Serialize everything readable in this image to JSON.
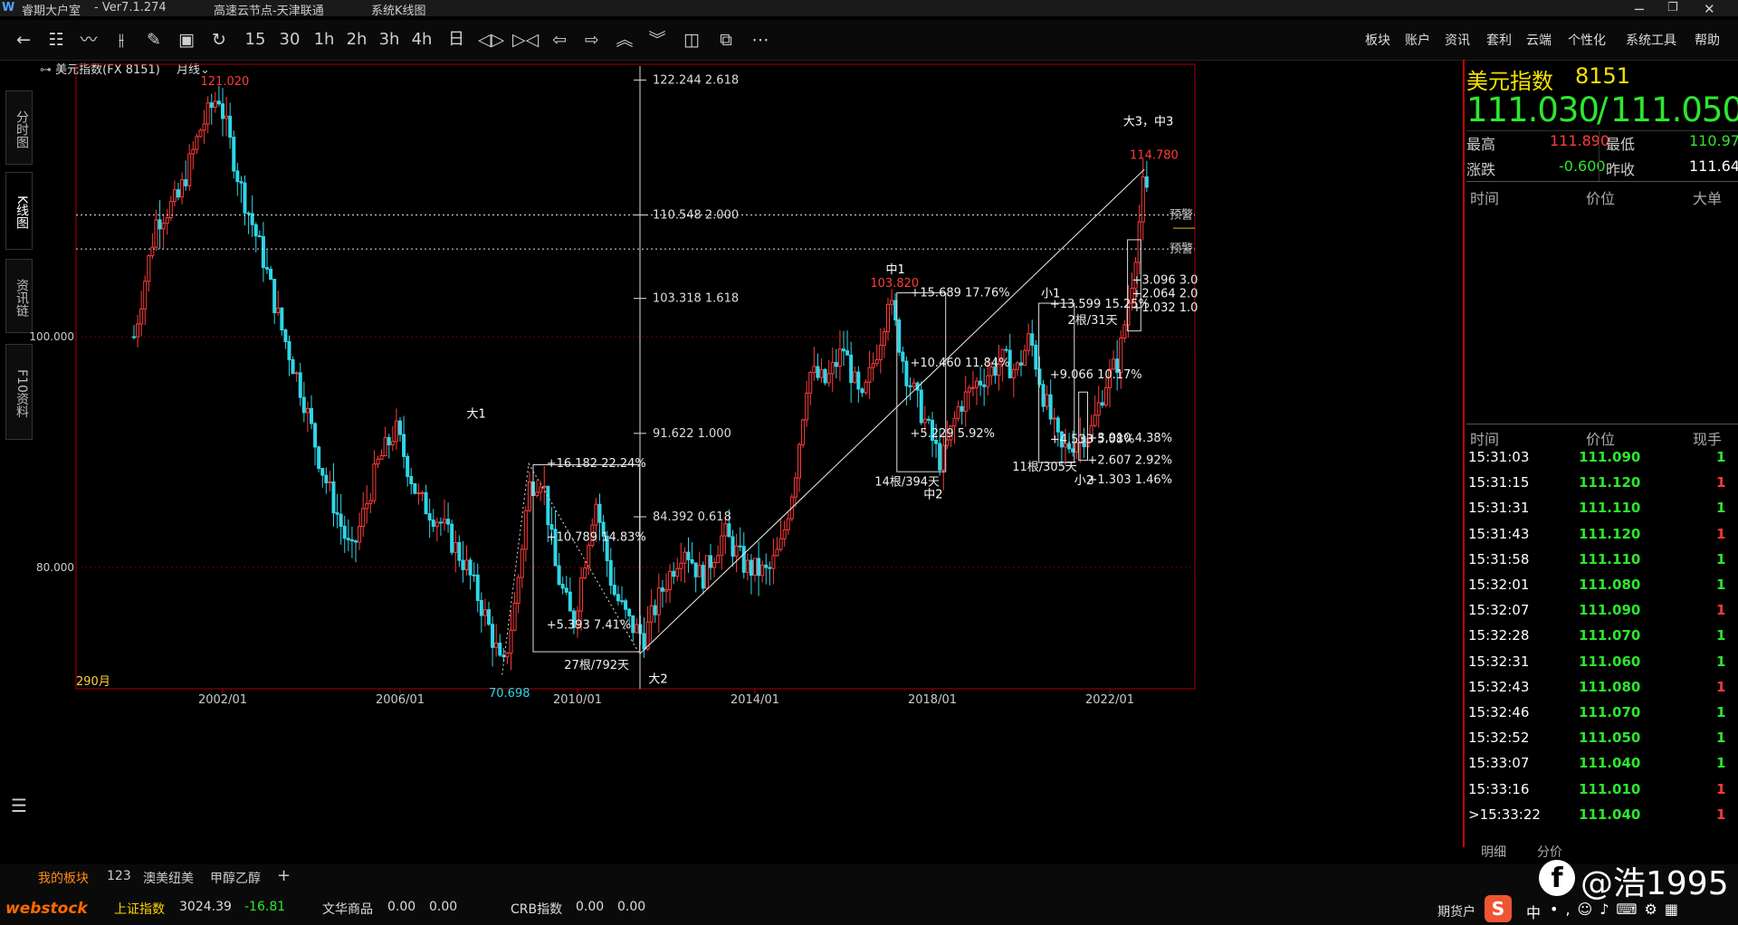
{
  "titlebar": {
    "app_name": "睿期大户室",
    "version": "- Ver7.1.274",
    "server": "高速云节点-天津联通",
    "window_name": "系统K线图"
  },
  "toolbar": {
    "period_buttons": [
      "15",
      "30",
      "1h",
      "2h",
      "3h",
      "4h",
      "日"
    ],
    "menu": [
      "板块",
      "账户",
      "资讯",
      "套利",
      "云端",
      "个性化",
      "系统工具",
      "帮助"
    ]
  },
  "left_tabs": [
    "分时图",
    "K线图",
    "资讯链",
    "F10资料"
  ],
  "chart_header": {
    "symbol": "美元指数(FX 8151)",
    "period": "月线"
  },
  "chart_data": {
    "type": "candlestick",
    "title": "美元指数(FX 8151) 月线",
    "bar_count_label": "290月",
    "x_ticks": [
      "2002/01",
      "2006/01",
      "2010/01",
      "2014/01",
      "2018/01",
      "2022/01"
    ],
    "y_ticks": [
      "100.000",
      "80.000"
    ],
    "high_label": "121.020",
    "low_label": "70.698",
    "peak_mid": "103.820",
    "last_high": "114.780",
    "fib_levels": [
      {
        "price": "122.244",
        "ratio": "2.618"
      },
      {
        "price": "110.548",
        "ratio": "2.000"
      },
      {
        "price": "103.318",
        "ratio": "1.618"
      },
      {
        "price": "91.622",
        "ratio": "1.000"
      },
      {
        "price": "84.392",
        "ratio": "0.618"
      }
    ],
    "wave_labels": [
      "大1",
      "大2",
      "中1",
      "中2",
      "小1",
      "小2",
      "大3，中3"
    ],
    "measure_labels": [
      "+16.182  22.24%",
      "+10.789  14.83%",
      "+5.393  7.41%",
      "27根/792天",
      "+15.689  17.76%",
      "+10.460  11.84%",
      "+5.229  5.92%",
      "14根/394天",
      "+13.599  15.25%",
      "+9.066  10.17%",
      "+4.533  5.08%",
      "11根/305天",
      "+3.910  4.38%",
      "+2.607  2.92%",
      "+1.303  1.46%",
      "2根/31天",
      "+3.096  3.0",
      "+2.064  2.0",
      "+1.032  1.0"
    ],
    "alert_labels": [
      "预警",
      "预警"
    ],
    "alert_prices": [
      110.548,
      107.6
    ]
  },
  "quote": {
    "name": "美元指数",
    "code": "8151",
    "bid": "111.030",
    "ask": "111.050",
    "high_label": "最高",
    "high": "111.890",
    "low_label": "最低",
    "low": "110.970",
    "change_label": "涨跌",
    "change": "-0.600",
    "prev_close_label": "昨收",
    "prev_close": "111.640"
  },
  "big_orders": {
    "headers": [
      "时间",
      "价位",
      "大单"
    ]
  },
  "ticks": {
    "headers": [
      "时间",
      "价位",
      "现手"
    ],
    "rows": [
      {
        "time": "15:31:03",
        "price": "111.090",
        "vol": "1",
        "vcolor": "#2ee62e"
      },
      {
        "time": "15:31:15",
        "price": "111.120",
        "vol": "1",
        "vcolor": "#ff3b3b"
      },
      {
        "time": "15:31:31",
        "price": "111.110",
        "vol": "1",
        "vcolor": "#2ee62e"
      },
      {
        "time": "15:31:43",
        "price": "111.120",
        "vol": "1",
        "vcolor": "#ff3b3b"
      },
      {
        "time": "15:31:58",
        "price": "111.110",
        "vol": "1",
        "vcolor": "#2ee62e"
      },
      {
        "time": "15:32:01",
        "price": "111.080",
        "vol": "1",
        "vcolor": "#2ee62e"
      },
      {
        "time": "15:32:07",
        "price": "111.090",
        "vol": "1",
        "vcolor": "#ff3b3b"
      },
      {
        "time": "15:32:28",
        "price": "111.070",
        "vol": "1",
        "vcolor": "#2ee62e"
      },
      {
        "time": "15:32:31",
        "price": "111.060",
        "vol": "1",
        "vcolor": "#2ee62e"
      },
      {
        "time": "15:32:43",
        "price": "111.080",
        "vol": "1",
        "vcolor": "#ff3b3b"
      },
      {
        "time": "15:32:46",
        "price": "111.070",
        "vol": "1",
        "vcolor": "#2ee62e"
      },
      {
        "time": "15:32:52",
        "price": "111.050",
        "vol": "1",
        "vcolor": "#2ee62e"
      },
      {
        "time": "15:33:07",
        "price": "111.040",
        "vol": "1",
        "vcolor": "#2ee62e"
      },
      {
        "time": "15:33:16",
        "price": "111.010",
        "vol": "1",
        "vcolor": "#ff3b3b"
      },
      {
        "time": "15:33:22",
        "price": "111.040",
        "vol": "1",
        "vcolor": "#ff3b3b"
      }
    ]
  },
  "panel_tabs": [
    "明细",
    "分价"
  ],
  "bottom": {
    "tabs": [
      "我的板块",
      "123",
      "澳美纽美",
      "甲醇乙醇"
    ],
    "add": "+",
    "brand": "webstock",
    "tickers": [
      {
        "name": "上证指数",
        "value": "3024.39",
        "change": "-16.81"
      },
      {
        "name": "文华商品",
        "value": "0.00",
        "change": "0.00"
      },
      {
        "name": "CRB指数",
        "value": "0.00",
        "change": "0.00"
      }
    ],
    "account_type": "期货户",
    "ime": "中",
    "watermark": "@浩1995"
  }
}
